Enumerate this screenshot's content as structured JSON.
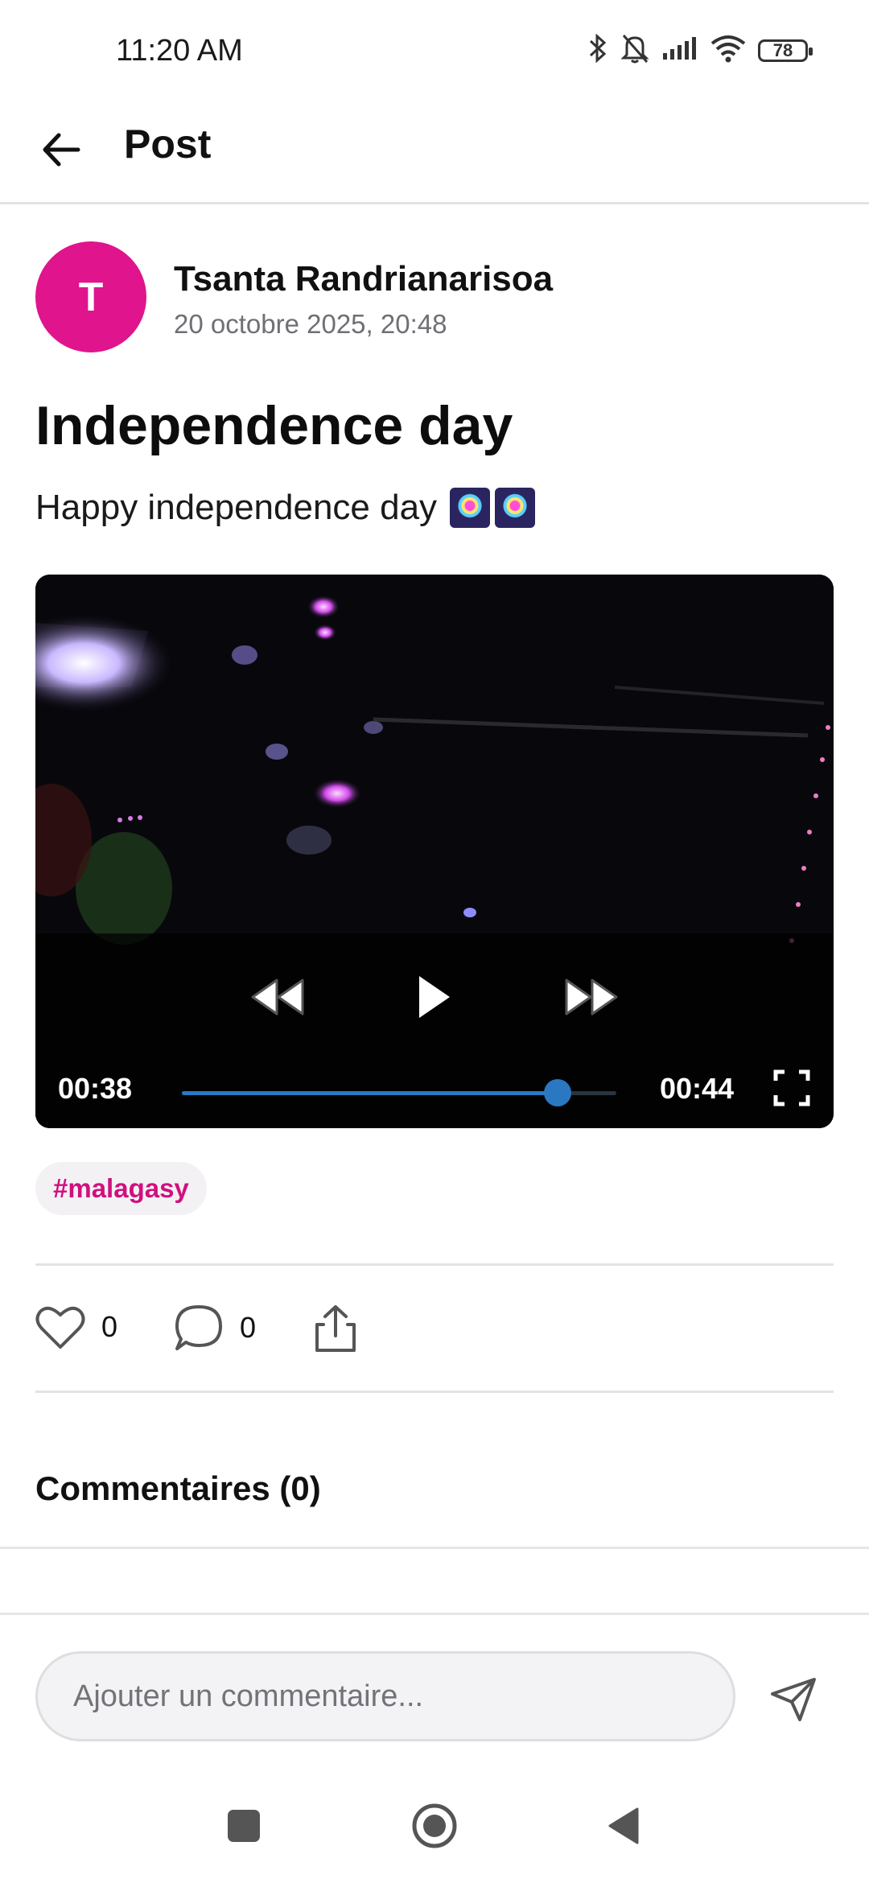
{
  "status_bar": {
    "time": "11:20 AM",
    "battery": "78",
    "icons": [
      "bluetooth-icon",
      "notifications-off-icon",
      "signal-icon",
      "wifi-icon",
      "battery-icon"
    ]
  },
  "header": {
    "title": "Post"
  },
  "post": {
    "author_initial": "T",
    "author_name": "Tsanta Randrianarisoa",
    "date": "20 octobre 2025, 20:48",
    "title": "Independence day",
    "body": "Happy independence day",
    "body_emoji": "fireworks-icon",
    "avatar_color": "#E0148C",
    "hashtag": "#malagasy",
    "hashtag_color": "#D0107F"
  },
  "video": {
    "current_time": "00:38",
    "total_time": "00:44",
    "progress": 0.864,
    "accent_color": "#2A78C2",
    "state": "paused"
  },
  "actions": {
    "likes": "0",
    "comments": "0"
  },
  "comments": {
    "heading": "Commentaires (0)",
    "input_placeholder": "Ajouter un commentaire..."
  }
}
